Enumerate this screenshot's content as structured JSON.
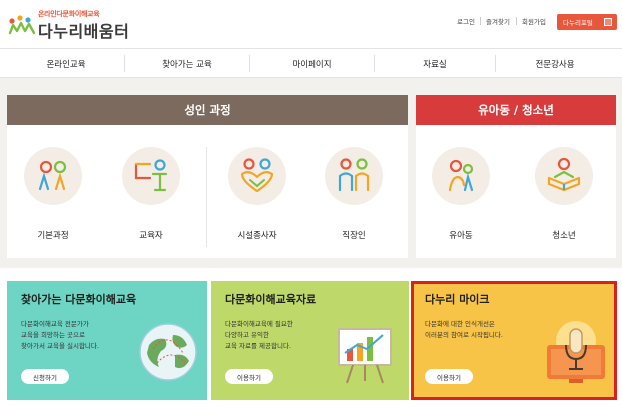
{
  "header": {
    "logo_tagline": "온라인다문화이해교육",
    "logo_name": "다누리배움터",
    "util_links": [
      "로그인",
      "즐겨찾기",
      "회원가입"
    ],
    "portal_button": "다누리포털"
  },
  "nav": {
    "items": [
      "온라인교육",
      "찾아가는 교육",
      "마이페이지",
      "자료실",
      "전문강사용"
    ]
  },
  "adult": {
    "title": "성인 과정",
    "items": [
      {
        "label": "기본과정",
        "icon": "people-icon"
      },
      {
        "label": "교육자",
        "icon": "educator-icon"
      },
      {
        "label": "시설종사자",
        "icon": "heart-people-icon"
      },
      {
        "label": "직장인",
        "icon": "workers-icon"
      }
    ]
  },
  "youth": {
    "title": "유아동 / 청소년",
    "items": [
      {
        "label": "유아동",
        "icon": "child-icon"
      },
      {
        "label": "청소년",
        "icon": "teen-reading-icon"
      }
    ]
  },
  "cards": [
    {
      "title": "찾아가는 다문화이해교육",
      "desc": [
        "다문화이해교육 전문가가",
        "교육을 희망하는 곳으로",
        "찾아가서 교육을 실시합니다."
      ],
      "button": "신청하기",
      "color": "#6ed4c4"
    },
    {
      "title": "다문화이해교육자료",
      "desc": [
        "다문화이해교육에 필요한",
        "다양하고 유익한",
        "교육 자료를 제공합니다."
      ],
      "button": "이용하기",
      "color": "#bfd86a"
    },
    {
      "title": "다누리 마이크",
      "desc": [
        "다문화에 대한 인식개선은",
        "이러분의 참여로 시작됩니다."
      ],
      "button": "이용하기",
      "color": "#f8c448"
    }
  ]
}
